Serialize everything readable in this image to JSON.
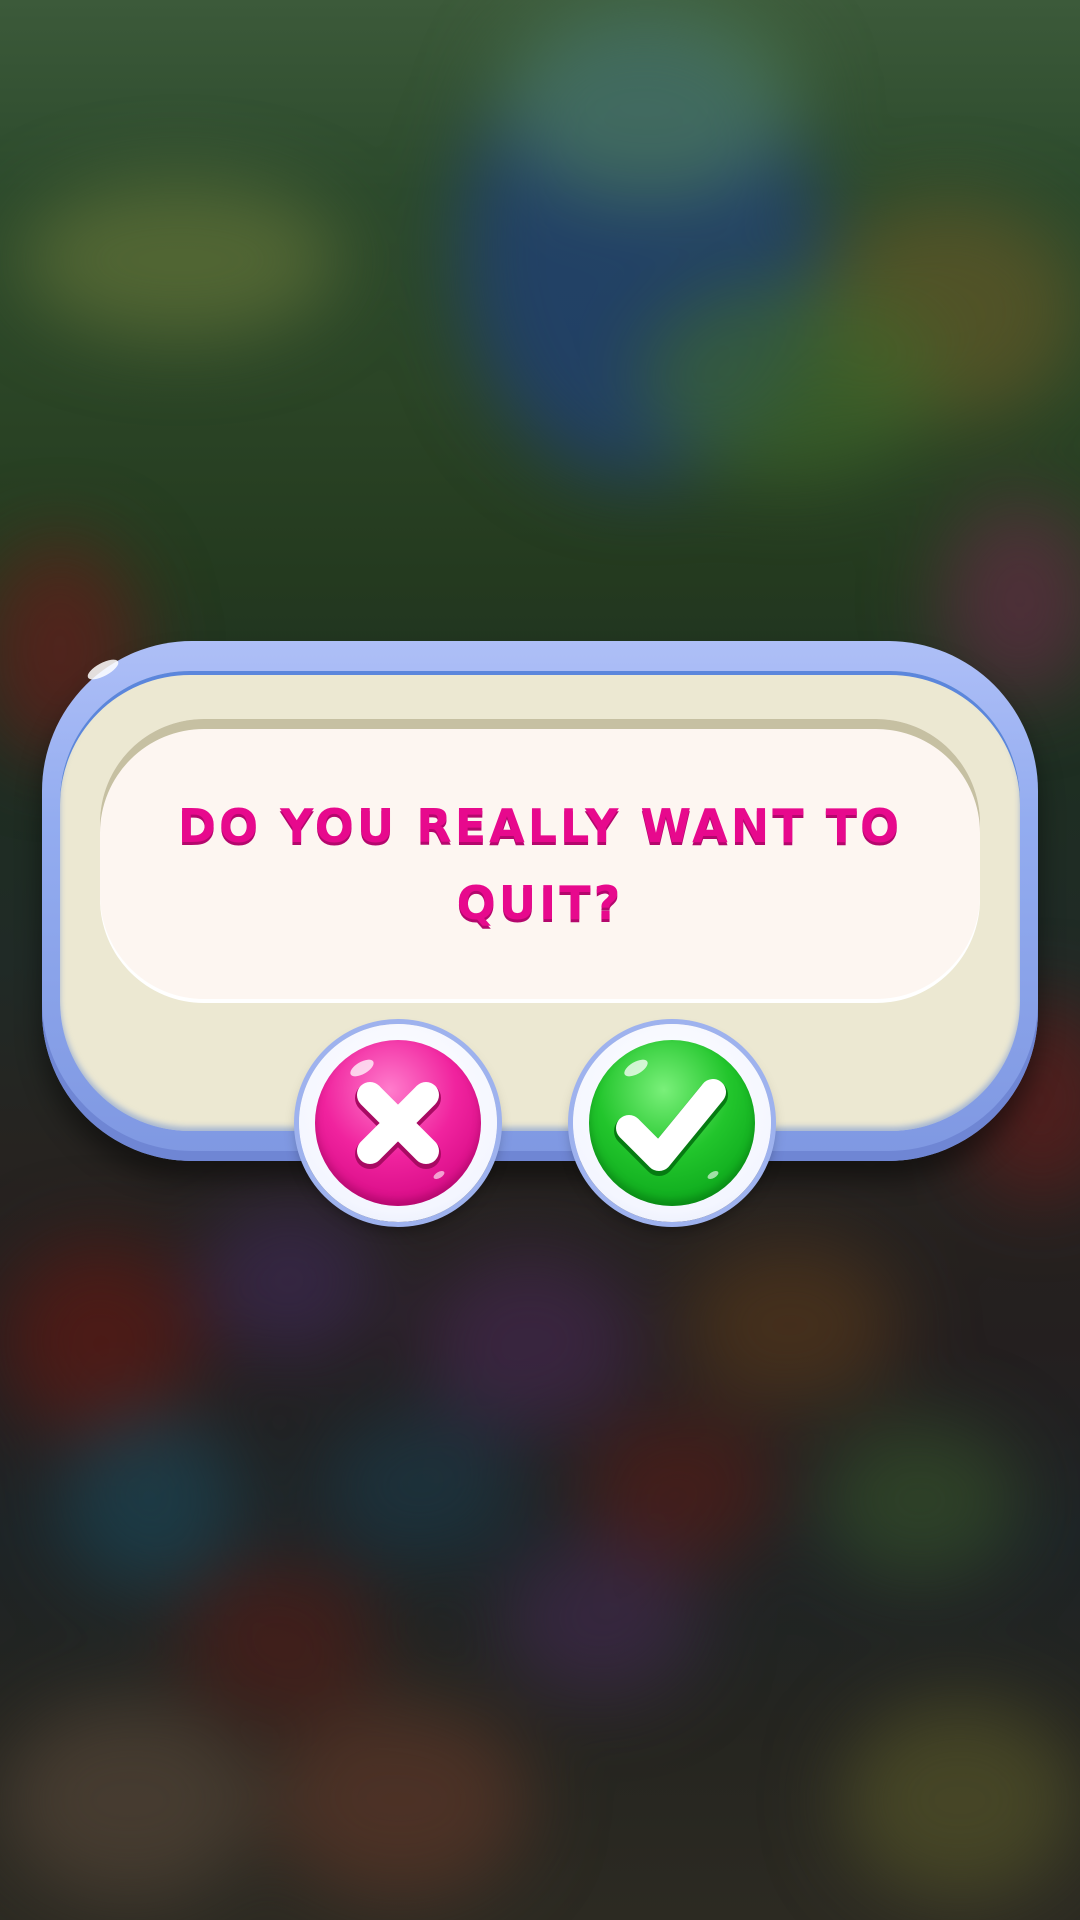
{
  "background": {
    "description_colors": [
      "#3c5a3a",
      "#2b4526",
      "#202a26",
      "#241f1f",
      "#2c2a22"
    ]
  },
  "dialog": {
    "message": "DO YOU REALLY WANT TO QUIT?",
    "message_color": "#e7098d",
    "frame_color": "#93acf0",
    "panel_color": "#ece8d2"
  },
  "buttons": {
    "cancel": {
      "icon": "close-icon",
      "color": "#e7179a"
    },
    "confirm": {
      "icon": "checkmark-icon",
      "color": "#13b321"
    }
  }
}
